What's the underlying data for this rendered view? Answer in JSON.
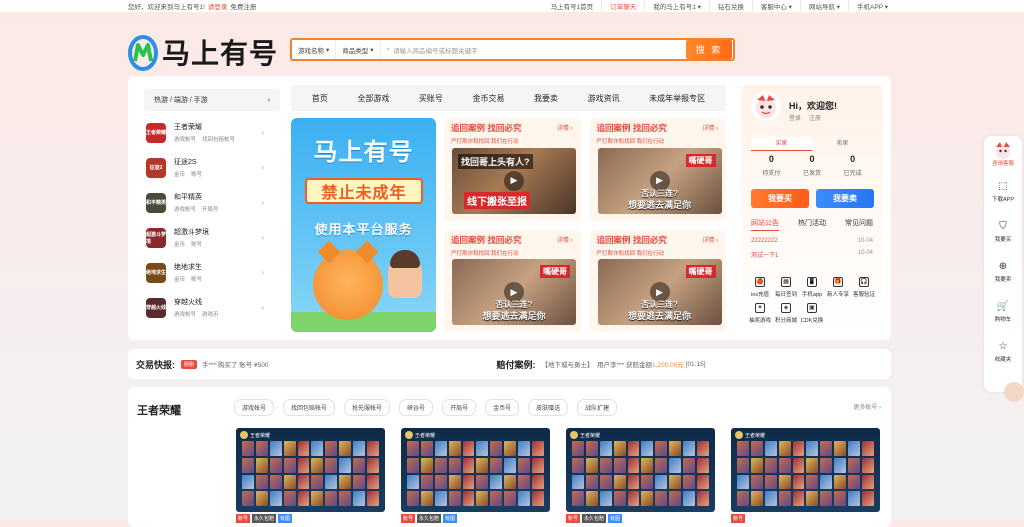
{
  "topbar": {
    "welcome": "您好，欢迎来到马上有号1!",
    "login": "请登录",
    "register": "免费注册",
    "links": [
      "马上有号1首页",
      "订单聊天",
      "我的马上有号1 ▾",
      "钻石兑换",
      "客服中心 ▾",
      "网站导航 ▾",
      "手机APP ▾"
    ]
  },
  "logo": {
    "text": "马上有号"
  },
  "search": {
    "game_select": "游戏名称",
    "type_select": "商品类型",
    "placeholder": "请输入商品编号或标题关键字",
    "button": "搜 索"
  },
  "category": {
    "head": "热游 / 端游 / 手游",
    "items": [
      {
        "name": "王者荣耀",
        "tags": [
          "游戏帐号",
          "找回包赔帐号"
        ],
        "color": "#c8282a",
        "icon_text": "王者荣耀"
      },
      {
        "name": "征途2S",
        "tags": [
          "金币",
          "账号"
        ],
        "color": "#b5372a",
        "icon_text": "征途2"
      },
      {
        "name": "和平精英",
        "tags": [
          "游戏帐号",
          "开局号"
        ],
        "color": "#4b4a3a",
        "icon_text": "和平精英"
      },
      {
        "name": "超激斗梦境",
        "tags": [
          "金币",
          "账号"
        ],
        "color": "#8a2a2a",
        "icon_text": "超激斗梦境"
      },
      {
        "name": "绝地求生",
        "tags": [
          "金币",
          "账号"
        ],
        "color": "#7a4a1a",
        "icon_text": "绝地求生"
      },
      {
        "name": "穿越火线",
        "tags": [
          "游戏帐号",
          "游戏币"
        ],
        "color": "#5a2a2a",
        "icon_text": "穿越火线"
      }
    ]
  },
  "nav": [
    "首页",
    "全部游戏",
    "买账号",
    "金币交易",
    "我要卖",
    "游戏资讯",
    "未成年举报专区"
  ],
  "banner": {
    "line1": "马上有号",
    "line2": "禁止未成年",
    "line3": "使用本平台服务"
  },
  "cases": [
    {
      "title": "追回案例 找回必究",
      "more": "详情 ›",
      "sub": "严打欺诈和找回 我们在行动",
      "cap1": "找回哥上头有人?",
      "cap2": "线下搬张至报",
      "style": "a"
    },
    {
      "title": "追回案例 找回必究",
      "more": "详情 ›",
      "sub": "严打欺诈和找回 我们在行动",
      "tag": "嘴硬哥",
      "mid": "否认三连?",
      "bot": "想要逃去满足你",
      "style": "b"
    },
    {
      "title": "追回案例 找回必究",
      "more": "详情 ›",
      "sub": "严打欺诈和找回 我们在行动",
      "tag": "嘴硬哥",
      "mid": "否认三连?",
      "bot": "想要逃去满足你",
      "style": "b"
    },
    {
      "title": "追回案例 找回必究",
      "more": "详情 ›",
      "sub": "严打欺诈和找回 我们在行动",
      "tag": "嘴硬哥",
      "mid": "否认三连?",
      "bot": "想要逃去满足你",
      "style": "b"
    }
  ],
  "user": {
    "greeting": "Hi，欢迎您!",
    "login": "登录",
    "register": "注册",
    "tabs": [
      "买家",
      "卖家"
    ],
    "stats": [
      {
        "n": "0",
        "l": "待支付"
      },
      {
        "n": "0",
        "l": "已发货"
      },
      {
        "n": "0",
        "l": "已完成"
      }
    ],
    "buy": "我要买",
    "sell": "我要卖",
    "news_tabs": [
      "网站公告",
      "热门活动",
      "常见问题"
    ],
    "news": [
      {
        "t": "22222222",
        "d": "10-04"
      },
      {
        "t": "测试一下1",
        "d": "10-04"
      }
    ],
    "services": [
      {
        "icon": "🍎",
        "label": "ios充值"
      },
      {
        "icon": "▦",
        "label": "每日签到"
      },
      {
        "icon": "📱",
        "label": "手机app"
      },
      {
        "icon": "🎁",
        "label": "新人专享"
      },
      {
        "icon": "🎧",
        "label": "客服验证"
      },
      {
        "icon": "✦",
        "label": "抽奖游戏"
      },
      {
        "icon": "◈",
        "label": "积分商城"
      },
      {
        "icon": "▣",
        "label": "CDK兑换"
      }
    ]
  },
  "ticker": {
    "label": "交易快报:",
    "badge": "刚刚",
    "text": "手*** 购买了 账号 ¥500",
    "label2": "赔付案例:",
    "case_game": "【地下城与勇士】",
    "case_text": "用户李*** 获赔金额",
    "case_amount": "1,200.00元",
    "case_time": "[01:15]"
  },
  "goods": {
    "title": "王者荣耀",
    "chips": [
      "游戏帐号",
      "找回包赔帐号",
      "抢先服帐号",
      "峡谷号",
      "开局号",
      "金币号",
      "皮肤赠送",
      "战队扩建"
    ],
    "more": "更多账号 ›",
    "card_header": "王者荣耀",
    "tags": [
      "账号",
      "永久包赔",
      "有图"
    ]
  },
  "rightbar": [
    {
      "icon": "",
      "label": "咨询客服"
    },
    {
      "icon": "⬚",
      "label": "下载APP"
    },
    {
      "icon": "⛉",
      "label": "我要买"
    },
    {
      "icon": "⊕",
      "label": "我要卖"
    },
    {
      "icon": "🛒",
      "label": "购物车"
    },
    {
      "icon": "☆",
      "label": "收藏夹"
    }
  ]
}
